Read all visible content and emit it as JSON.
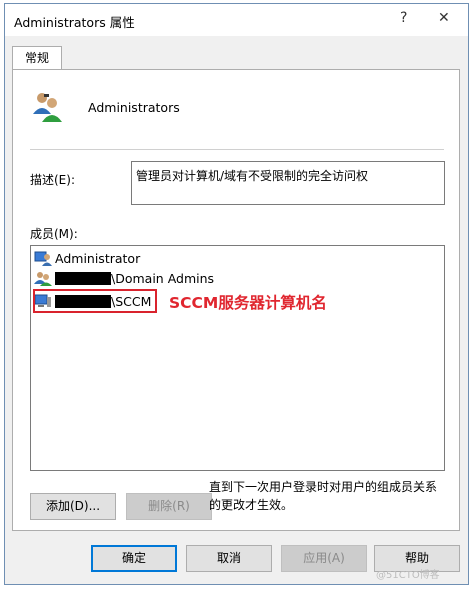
{
  "window": {
    "title": "Administrators 属性",
    "help_glyph": "?",
    "close_glyph": "✕"
  },
  "tabs": [
    {
      "label": "常规"
    }
  ],
  "group": {
    "name": "Administrators",
    "icon": "group-users-icon"
  },
  "description": {
    "label": "描述(E):",
    "value": "管理员对计算机/域有不受限制的完全访问权"
  },
  "members": {
    "label": "成员(M):",
    "items": [
      {
        "prefix": "",
        "text": "Administrator",
        "icon": "user-icon",
        "redacted": false
      },
      {
        "prefix": "",
        "text": "\\Domain Admins",
        "icon": "group-icon",
        "redacted": true
      },
      {
        "prefix": "",
        "text": "\\SCCM",
        "icon": "computer-icon",
        "redacted": true
      }
    ]
  },
  "annotation": {
    "text": "SCCM服务器计算机名",
    "color": "#e0262f"
  },
  "buttons": {
    "add": "添加(D)...",
    "remove": "删除(R)",
    "ok": "确定",
    "cancel": "取消",
    "apply": "应用(A)",
    "help": "帮助"
  },
  "note": "直到下一次用户登录时对用户的组成员关系的更改才生效。",
  "watermark": "@51CTO博客",
  "colors": {
    "accent": "#0078d7",
    "annotation_red": "#d9232d"
  }
}
